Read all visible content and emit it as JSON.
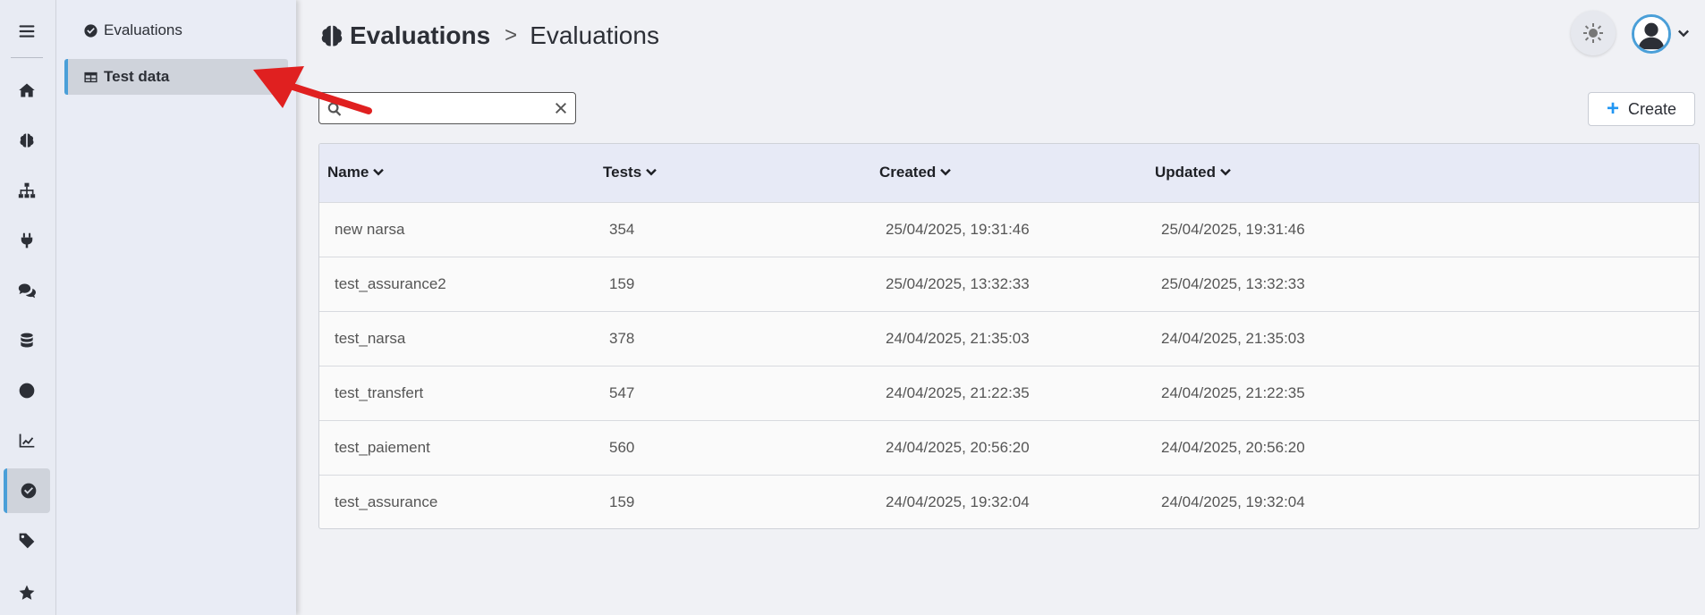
{
  "rail": {
    "items": [
      {
        "icon": "hamburger-menu-icon"
      },
      {
        "icon": "home-icon"
      },
      {
        "icon": "brain-icon"
      },
      {
        "icon": "sitemap-icon"
      },
      {
        "icon": "plug-icon"
      },
      {
        "icon": "chat-icon"
      },
      {
        "icon": "database-icon"
      },
      {
        "icon": "clock-icon"
      },
      {
        "icon": "chart-line-icon"
      },
      {
        "icon": "check-circle-icon",
        "active": true
      },
      {
        "icon": "tag-icon"
      },
      {
        "icon": "star-icon"
      }
    ]
  },
  "subnav": {
    "items": [
      {
        "label": "Evaluations",
        "icon": "check-circle-icon"
      },
      {
        "label": "Test data",
        "icon": "table-icon",
        "active": true
      }
    ]
  },
  "header": {
    "root": "Evaluations",
    "separator": ">",
    "current": "Evaluations"
  },
  "search": {
    "value": "",
    "placeholder": ""
  },
  "toolbar": {
    "create_label": "Create"
  },
  "table": {
    "columns": [
      "Name",
      "Tests",
      "Created",
      "Updated"
    ],
    "rows": [
      {
        "name": "new narsa",
        "tests": "354",
        "created": "25/04/2025, 19:31:46",
        "updated": "25/04/2025, 19:31:46"
      },
      {
        "name": "test_assurance2",
        "tests": "159",
        "created": "25/04/2025, 13:32:33",
        "updated": "25/04/2025, 13:32:33"
      },
      {
        "name": "test_narsa",
        "tests": "378",
        "created": "24/04/2025, 21:35:03",
        "updated": "24/04/2025, 21:35:03"
      },
      {
        "name": "test_transfert",
        "tests": "547",
        "created": "24/04/2025, 21:22:35",
        "updated": "24/04/2025, 21:22:35"
      },
      {
        "name": "test_paiement",
        "tests": "560",
        "created": "24/04/2025, 20:56:20",
        "updated": "24/04/2025, 20:56:20"
      },
      {
        "name": "test_assurance",
        "tests": "159",
        "created": "24/04/2025, 19:32:04",
        "updated": "24/04/2025, 19:32:04"
      }
    ]
  },
  "colors": {
    "accent": "#4a9fd8",
    "create_plus": "#2196f3",
    "annotation_arrow": "#e02020"
  }
}
